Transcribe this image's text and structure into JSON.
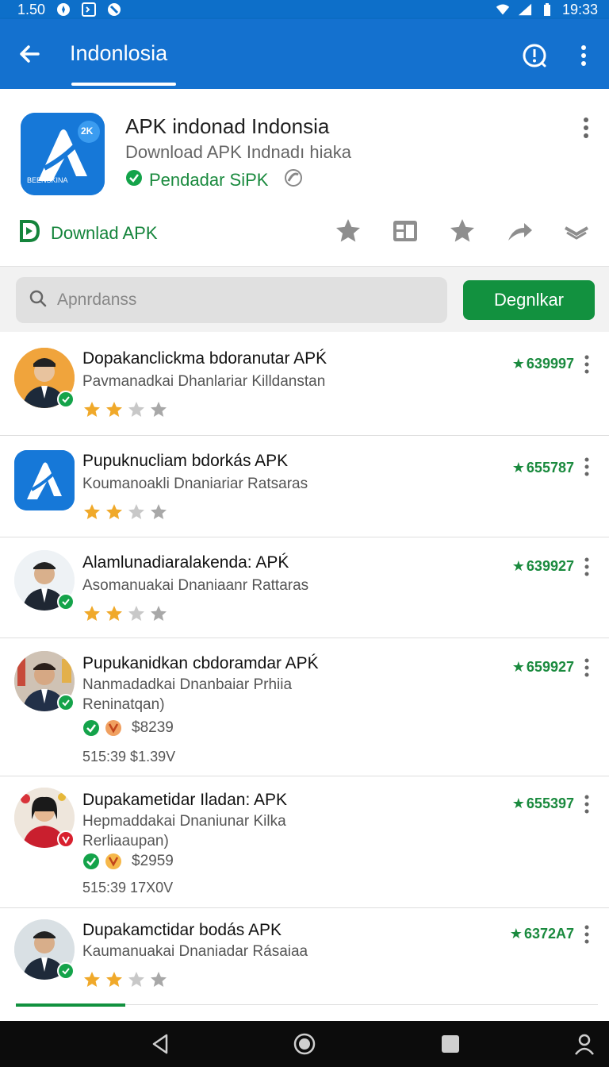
{
  "status_bar": {
    "left_time": "1.50",
    "clock": "19:33"
  },
  "app_bar": {
    "title": "Indonlosia"
  },
  "app": {
    "name": "APK indonad Indonsia",
    "subtitle": "Download APK Indnadı hiaka",
    "developer": "Pendadar SiPK",
    "icon_badge": "2K",
    "icon_caption": "BEENSKINA",
    "download_label": "Downlad APK"
  },
  "search": {
    "placeholder": "Apnrdanss",
    "button_label": "Degnlkar"
  },
  "items": [
    {
      "title": "Dopakanclickma bdoranutar APḰ",
      "subtitle": "Pavmanadkai Dhanlariar Killdanstan",
      "count": "639997",
      "rating": 2
    },
    {
      "title": "Pupuknucliam bdorkás APK",
      "subtitle": "Koumanoakli Dnaniariar Ratsaras",
      "count": "655787",
      "rating": 2
    },
    {
      "title": "Alamlunadiaralakenda: APḰ",
      "subtitle": "Asomanuakai Dnaniaanr Rattaras",
      "count": "639927",
      "rating": 2
    },
    {
      "title": "Pupukanidkan cbdoramdar APḰ",
      "subtitle": "Nanmadadkai Dnanbaiar Prhiia",
      "subtitle2": "Reninatqan)",
      "price": "$8239",
      "date": "515:39 $1.39V",
      "count": "659927"
    },
    {
      "title": "Dupakametidar Iladan: APK",
      "subtitle": "Hepmaddakai Dnaniunar Kilka",
      "subtitle2": "Rerliaaupan)",
      "price": "$2959",
      "date": "515:39 17X0V",
      "count": "655397"
    },
    {
      "title": "Dupakamctidar bodás APK",
      "subtitle": "Kaumanuakai Dnaniadar Rásaiaa",
      "count": "6372A7",
      "rating": 2
    }
  ],
  "colors": {
    "primary": "#1471cf",
    "accent_green": "#12913f",
    "star_gold": "#f0a92a",
    "star_gray": "#b0b0b0"
  }
}
